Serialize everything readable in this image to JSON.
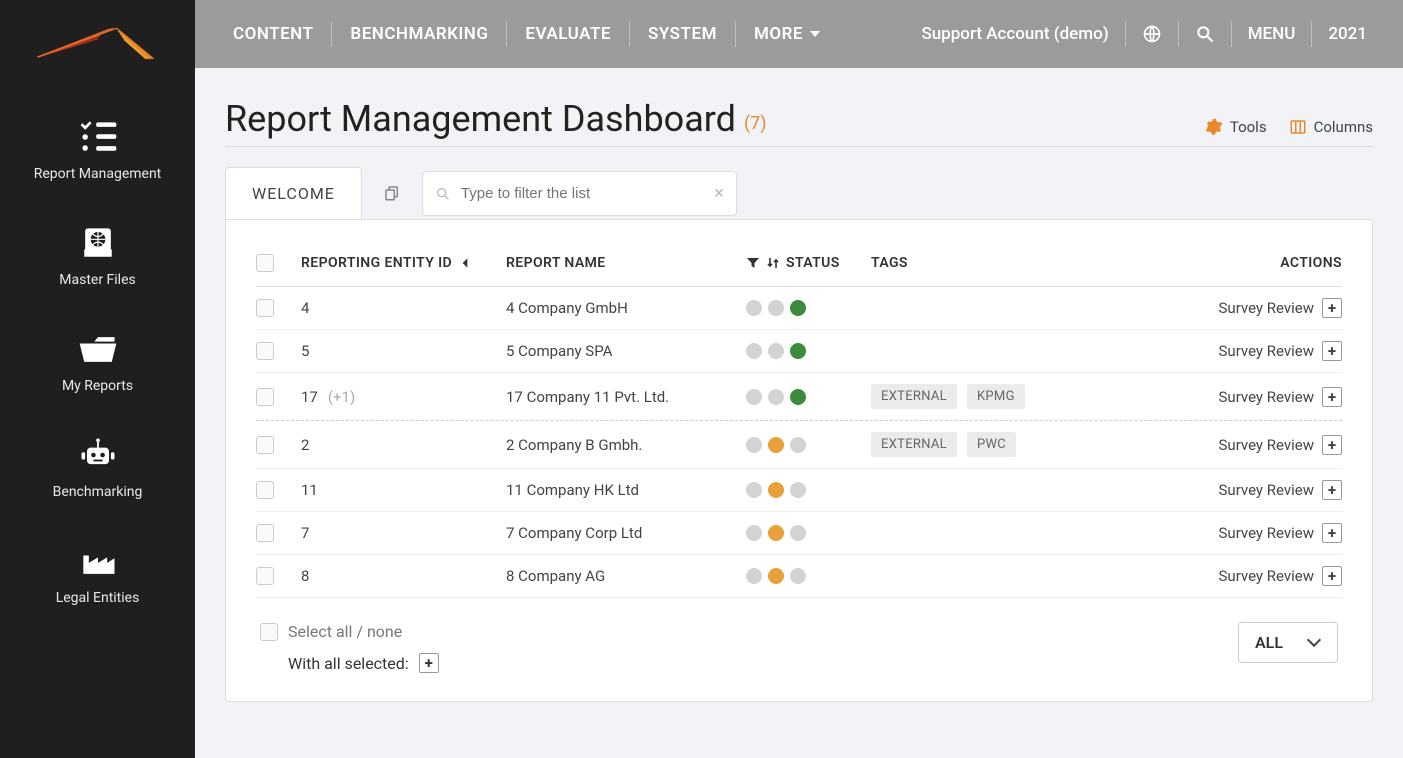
{
  "sidebar": {
    "items": [
      {
        "label": "Report Management"
      },
      {
        "label": "Master Files"
      },
      {
        "label": "My Reports"
      },
      {
        "label": "Benchmarking"
      },
      {
        "label": "Legal Entities"
      }
    ]
  },
  "topnav": {
    "items": [
      "CONTENT",
      "BENCHMARKING",
      "EVALUATE",
      "SYSTEM",
      "MORE"
    ]
  },
  "topright": {
    "account": "Support Account (demo)",
    "menu": "MENU",
    "year": "2021"
  },
  "page": {
    "title": "Report Management Dashboard",
    "count": "(7)",
    "tools": "Tools",
    "columns": "Columns"
  },
  "tabs": {
    "welcome": "WELCOME"
  },
  "filter": {
    "placeholder": "Type to filter the list"
  },
  "table": {
    "headers": {
      "entity_id": "REPORTING ENTITY ID",
      "name": "REPORT NAME",
      "status": "STATUS",
      "tags": "TAGS",
      "actions": "ACTIONS"
    },
    "action_label": "Survey Review",
    "rows": [
      {
        "id": "4",
        "idplus": "",
        "name": "4 Company GmbH",
        "status": [
          "gray",
          "gray",
          "green"
        ],
        "tags": [],
        "dashed": false
      },
      {
        "id": "5",
        "idplus": "",
        "name": "5 Company SPA",
        "status": [
          "gray",
          "gray",
          "green"
        ],
        "tags": [],
        "dashed": false
      },
      {
        "id": "17",
        "idplus": "(+1)",
        "name": "17 Company 11 Pvt. Ltd.",
        "status": [
          "gray",
          "gray",
          "green"
        ],
        "tags": [
          "EXTERNAL",
          "KPMG"
        ],
        "dashed": true
      },
      {
        "id": "2",
        "idplus": "",
        "name": "2 Company B Gmbh.",
        "status": [
          "gray",
          "orange",
          "gray"
        ],
        "tags": [
          "EXTERNAL",
          "PWC"
        ],
        "dashed": false
      },
      {
        "id": "11",
        "idplus": "",
        "name": "11 Company HK Ltd",
        "status": [
          "gray",
          "orange",
          "gray"
        ],
        "tags": [],
        "dashed": false
      },
      {
        "id": "7",
        "idplus": "",
        "name": "7 Company Corp Ltd",
        "status": [
          "gray",
          "orange",
          "gray"
        ],
        "tags": [],
        "dashed": false
      },
      {
        "id": "8",
        "idplus": "",
        "name": "8 Company AG",
        "status": [
          "gray",
          "orange",
          "gray"
        ],
        "tags": [],
        "dashed": false
      }
    ]
  },
  "footer": {
    "select_all": "Select all / none",
    "with_selected": "With all selected:",
    "filter_select": "ALL"
  }
}
